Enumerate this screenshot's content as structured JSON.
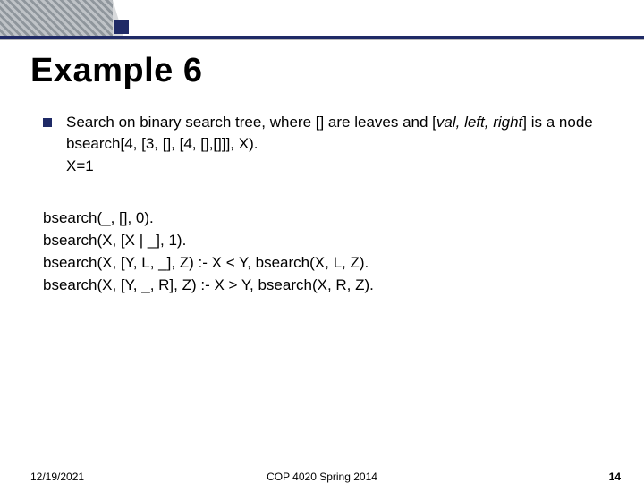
{
  "title": "Example 6",
  "bullet": {
    "line1_pre": "Search on binary search tree, where [] are leaves and [",
    "line1_ital": "val, left, right",
    "line1_post": "] is a node",
    "line2": "bsearch[4, [3, [], [4, [],[]]], X).",
    "line3": "X=1"
  },
  "code": [
    "bsearch(_, [], 0).",
    "bsearch(X, [X | _], 1).",
    "bsearch(X, [Y, L, _], Z) :- X < Y, bsearch(X, L, Z).",
    "bsearch(X, [Y, _, R], Z) :- X > Y, bsearch(X, R, Z)."
  ],
  "footer": {
    "date": "12/19/2021",
    "course": "COP 4020 Spring 2014",
    "page": "14"
  }
}
